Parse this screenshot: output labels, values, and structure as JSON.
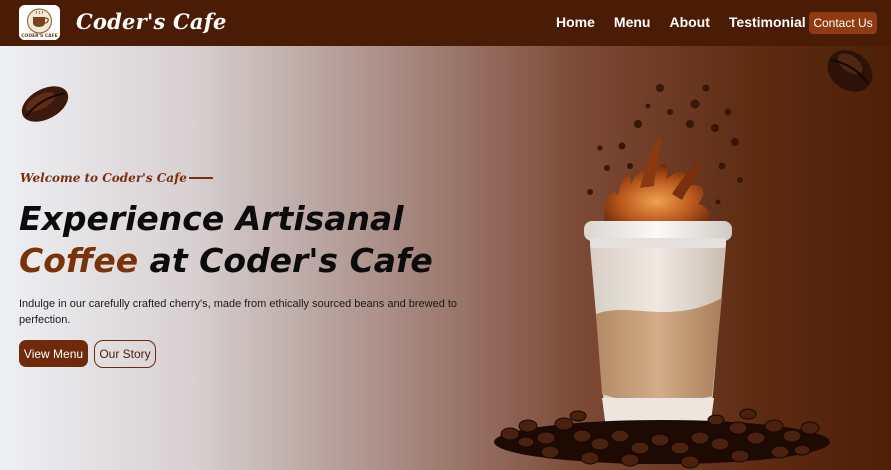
{
  "brand": {
    "name": "Coder's Cafe",
    "logo_text": "CODER'S CAFE",
    "logo_icon": "coffee-cup-logo"
  },
  "nav": {
    "links": [
      "Home",
      "Menu",
      "About",
      "Testimonial"
    ],
    "contact_label": "Contact Us"
  },
  "hero": {
    "welcome": "Welcome to Coder's Cafe",
    "headline_line1": "Experience Artisanal",
    "headline_accent": "Coffee",
    "headline_line2_rest": " at Coder's Cafe",
    "description": "Indulge in our carefully crafted cherry's, made from ethically sourced beans and brewed to perfection.",
    "primary_button": "View Menu",
    "secondary_button": "Our Story"
  },
  "images": {
    "bean_left": "coffee-bean-icon",
    "bean_right": "coffee-bean-icon",
    "hero_image": "coffee-cup-splash-with-beans"
  },
  "colors": {
    "nav_background": "#4a1c05",
    "accent_brown": "#6e2a0a",
    "contact_button": "#8f3a10",
    "headline_accent": "#7a3209"
  }
}
